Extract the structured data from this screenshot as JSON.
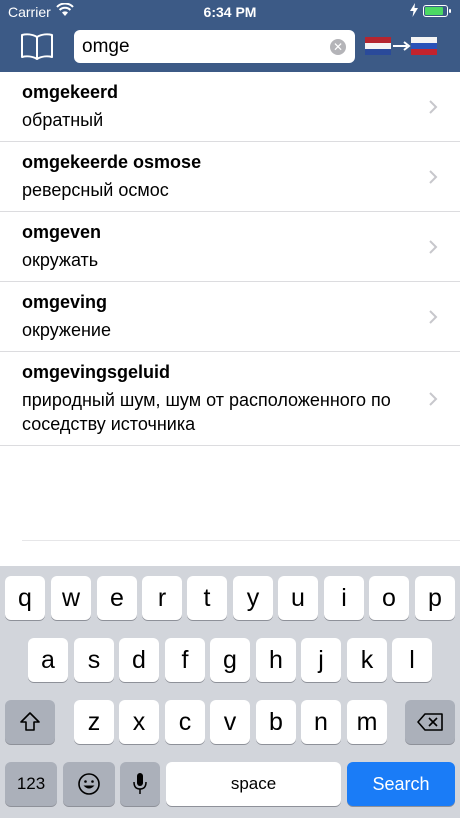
{
  "status_bar": {
    "carrier": "Carrier",
    "time": "6:34 PM",
    "battery_level": 0.8
  },
  "header": {
    "book_icon": "book-icon",
    "search": {
      "value": "omge",
      "clear_icon": "clear-circle-icon"
    },
    "language_pair": {
      "from_flag": "netherlands-flag-icon",
      "arrow": "arrow-right-icon",
      "to_flag": "russia-flag-icon"
    },
    "bar_color": "#3c5a86"
  },
  "results": [
    {
      "head": "omgekeerd",
      "translation": "обратный"
    },
    {
      "head": "omgekeerde osmose",
      "translation": "реверсный осмос"
    },
    {
      "head": "omgeven",
      "translation": "окружать"
    },
    {
      "head": "omgeving",
      "translation": "окружение"
    },
    {
      "head": "omgevingsgeluid",
      "translation": "природный шум, шум от расположенного по соседству источника"
    }
  ],
  "keyboard": {
    "row1": [
      "q",
      "w",
      "e",
      "r",
      "t",
      "y",
      "u",
      "i",
      "o",
      "p"
    ],
    "row2": [
      "a",
      "s",
      "d",
      "f",
      "g",
      "h",
      "j",
      "k",
      "l"
    ],
    "row3": [
      "z",
      "x",
      "c",
      "v",
      "b",
      "n",
      "m"
    ],
    "shift_icon": "shift-icon",
    "backspace_icon": "backspace-icon",
    "numbers_label": "123",
    "emoji_icon": "emoji-icon",
    "mic_icon": "microphone-icon",
    "space_label": "space",
    "search_label": "Search",
    "search_color": "#1a7cf7"
  }
}
